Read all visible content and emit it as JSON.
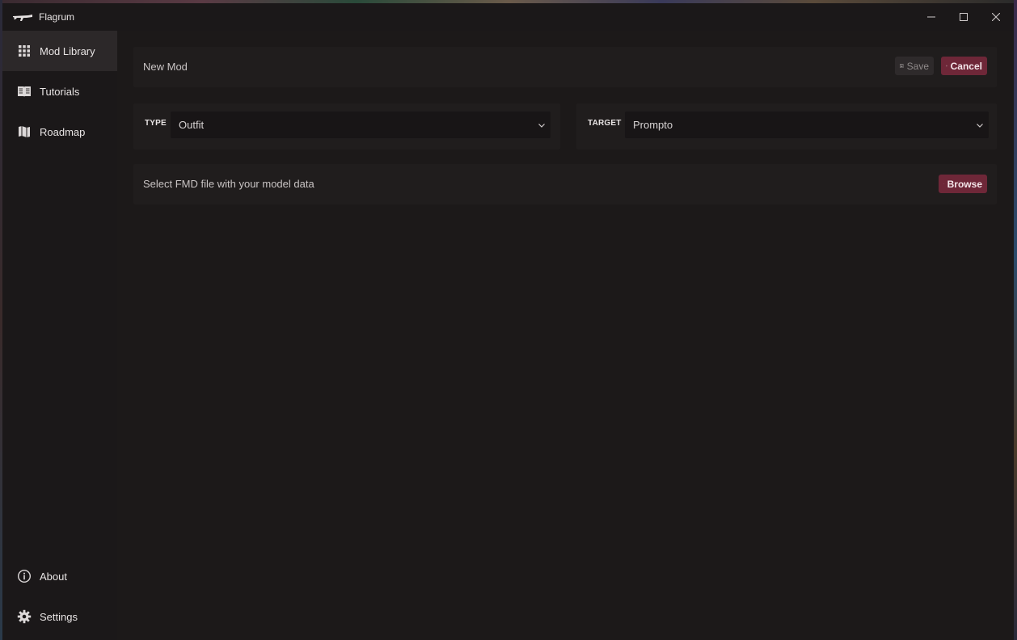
{
  "window": {
    "title": "Flagrum",
    "minimize_icon": "minimize-icon",
    "maximize_icon": "maximize-icon",
    "close_icon": "close-icon"
  },
  "sidebar": {
    "items": [
      {
        "label": "Mod Library",
        "icon": "grid-icon",
        "active": true
      },
      {
        "label": "Tutorials",
        "icon": "book-icon",
        "active": false
      },
      {
        "label": "Roadmap",
        "icon": "map-icon",
        "active": false
      }
    ],
    "bottom_items": [
      {
        "label": "About",
        "icon": "info-icon"
      },
      {
        "label": "Settings",
        "icon": "gear-icon"
      }
    ]
  },
  "editor": {
    "title_placeholder": "New Mod",
    "save_label": "Save",
    "cancel_label": "Cancel",
    "type_label": "TYPE",
    "type_value": "Outfit",
    "target_label": "TARGET",
    "target_value": "Prompto",
    "file_prompt": "Select FMD file with your model data",
    "browse_label": "Browse"
  },
  "colors": {
    "accent": "#6e2738",
    "background": "#1b1819",
    "active_nav": "#2c2829"
  }
}
